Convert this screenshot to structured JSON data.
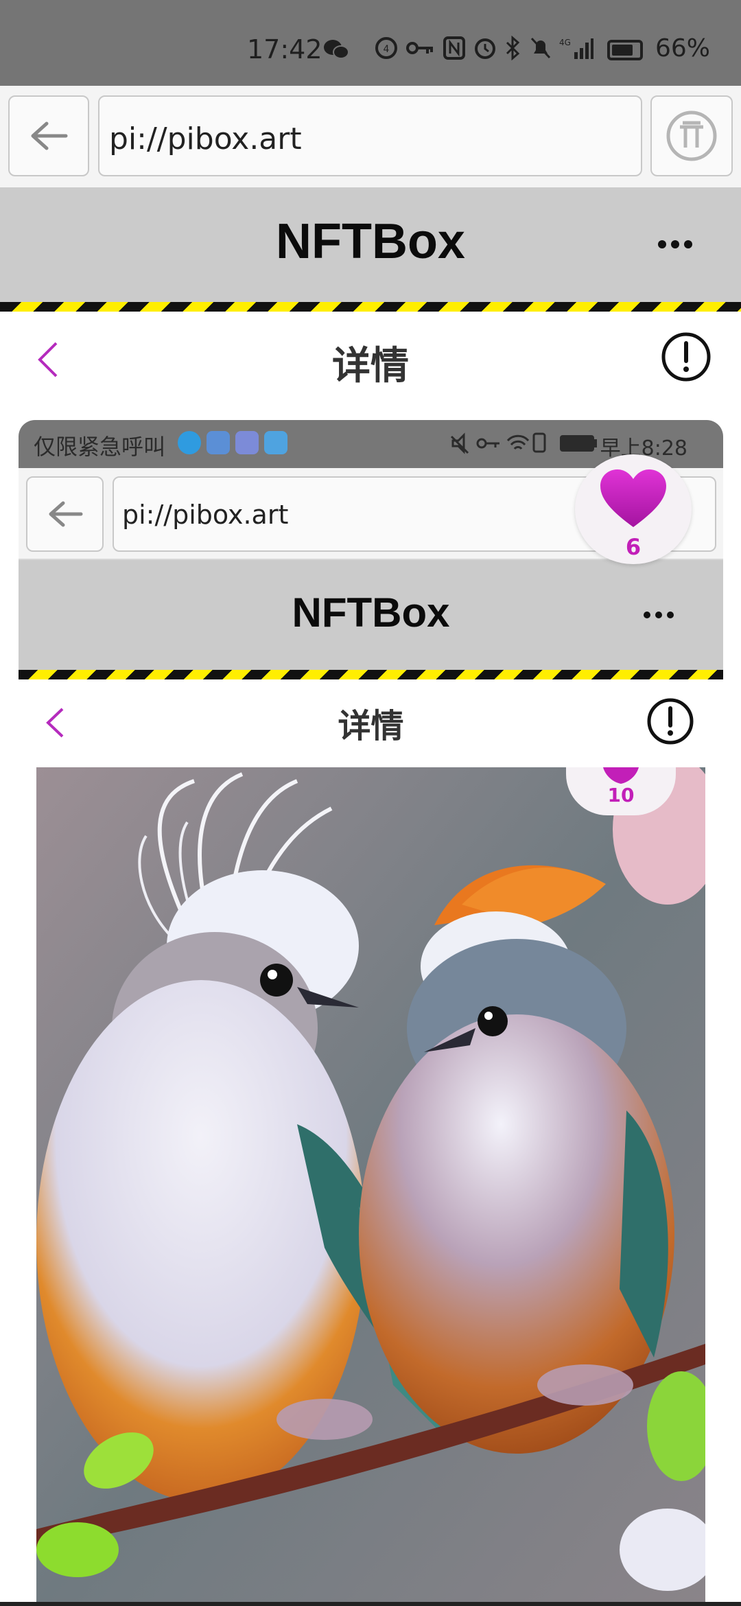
{
  "status_bar": {
    "time": "17:42",
    "battery_percent": "66%",
    "icons": [
      "wechat-icon",
      "hd-icon",
      "key-icon",
      "nfc-icon",
      "alarm-icon",
      "bluetooth-icon",
      "mute-icon",
      "4g-signal-icon",
      "battery-icon"
    ]
  },
  "browser": {
    "url": "pi://pibox.art",
    "back_icon": "arrow-left-icon",
    "pi_icon": "pi-logo-icon"
  },
  "app_header": {
    "title": "NFTBox",
    "menu_icon": "more-dots-icon"
  },
  "page_header": {
    "title": "详情",
    "back_icon": "chevron-left-icon",
    "info_icon": "exclamation-circle-icon"
  },
  "embedded_screenshot": {
    "status_left": "仅限紧急呼叫",
    "status_time": "早上8:28",
    "url": "pi://pibox.art",
    "app_title": "NFTBox",
    "page_title": "详情",
    "like_count": "10",
    "artwork": "two-birds-on-branch"
  },
  "like_button": {
    "count": "6",
    "icon": "heart-icon",
    "color": "#c21fb8"
  },
  "colors": {
    "accent": "#b52bbd",
    "hazard_yellow": "#ffee00",
    "header_gray": "#cbcbcb"
  }
}
